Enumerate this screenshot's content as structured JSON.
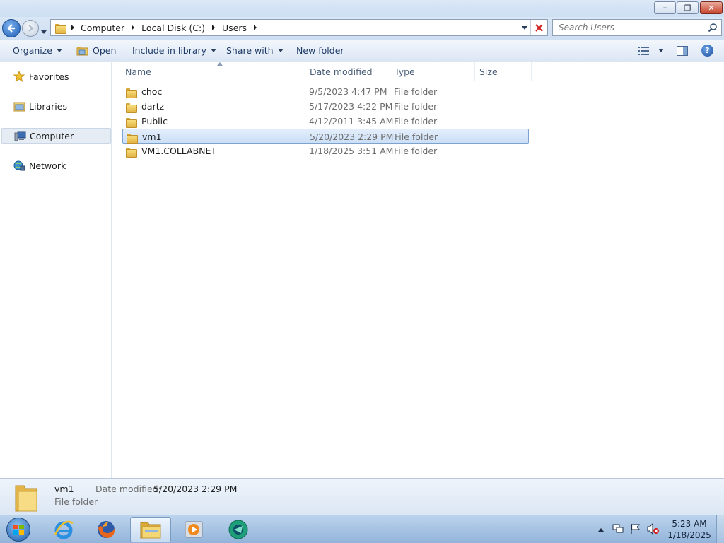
{
  "window": {
    "minimize_glyph": "–",
    "maximize_glyph": "❐",
    "close_glyph": "✕"
  },
  "address": {
    "crumbs": [
      "Computer",
      "Local Disk (C:)",
      "Users"
    ]
  },
  "search": {
    "placeholder": "Search Users"
  },
  "toolbar": {
    "organize": "Organize",
    "open": "Open",
    "include_in_library": "Include in library",
    "share_with": "Share with",
    "new_folder": "New folder"
  },
  "nav": {
    "favorites": "Favorites",
    "libraries": "Libraries",
    "computer": "Computer",
    "network": "Network"
  },
  "columns": {
    "name": "Name",
    "date_modified": "Date modified",
    "type": "Type",
    "size": "Size"
  },
  "rows": [
    {
      "name": "choc",
      "date": "9/5/2023 4:47 PM",
      "type": "File folder",
      "size": ""
    },
    {
      "name": "dartz",
      "date": "5/17/2023 4:22 PM",
      "type": "File folder",
      "size": ""
    },
    {
      "name": "Public",
      "date": "4/12/2011 3:45 AM",
      "type": "File folder",
      "size": ""
    },
    {
      "name": "vm1",
      "date": "5/20/2023 2:29 PM",
      "type": "File folder",
      "size": ""
    },
    {
      "name": "VM1.COLLABNET",
      "date": "1/18/2025 3:51 AM",
      "type": "File folder",
      "size": ""
    }
  ],
  "selected_row": 3,
  "details": {
    "name": "vm1",
    "date_label": "Date modified:",
    "date_value": "5/20/2023 2:29 PM",
    "type": "File folder"
  },
  "taskbar": {
    "time": "5:23 AM",
    "date": "1/18/2025"
  },
  "colors": {
    "accent": "#1a5bb4",
    "selection": "#cbdff7",
    "close_red": "#c8442c"
  }
}
